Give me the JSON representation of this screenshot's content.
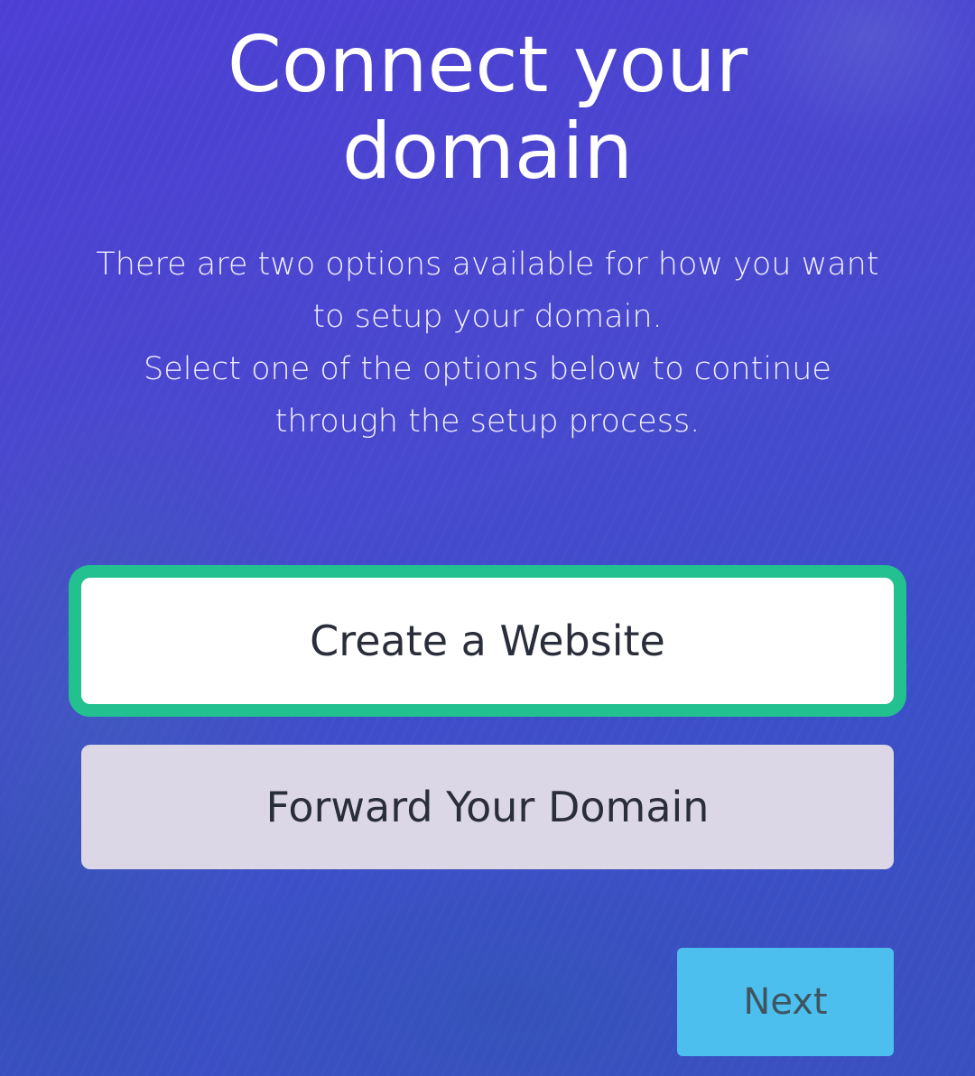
{
  "page": {
    "title": "Connect your\ndomain",
    "description": "There are two options available for how you want\nto setup your domain.\nSelect one of the options below to continue\nthrough the setup process."
  },
  "options": [
    {
      "label": "Create a Website",
      "selected": true
    },
    {
      "label": "Forward Your Domain",
      "selected": false
    }
  ],
  "actions": {
    "next_label": "Next"
  },
  "colors": {
    "background": "#4a47cf",
    "selected_outline": "#22c18f",
    "next_button": "#4dbfee",
    "unselected_option": "#dcd7e6"
  }
}
